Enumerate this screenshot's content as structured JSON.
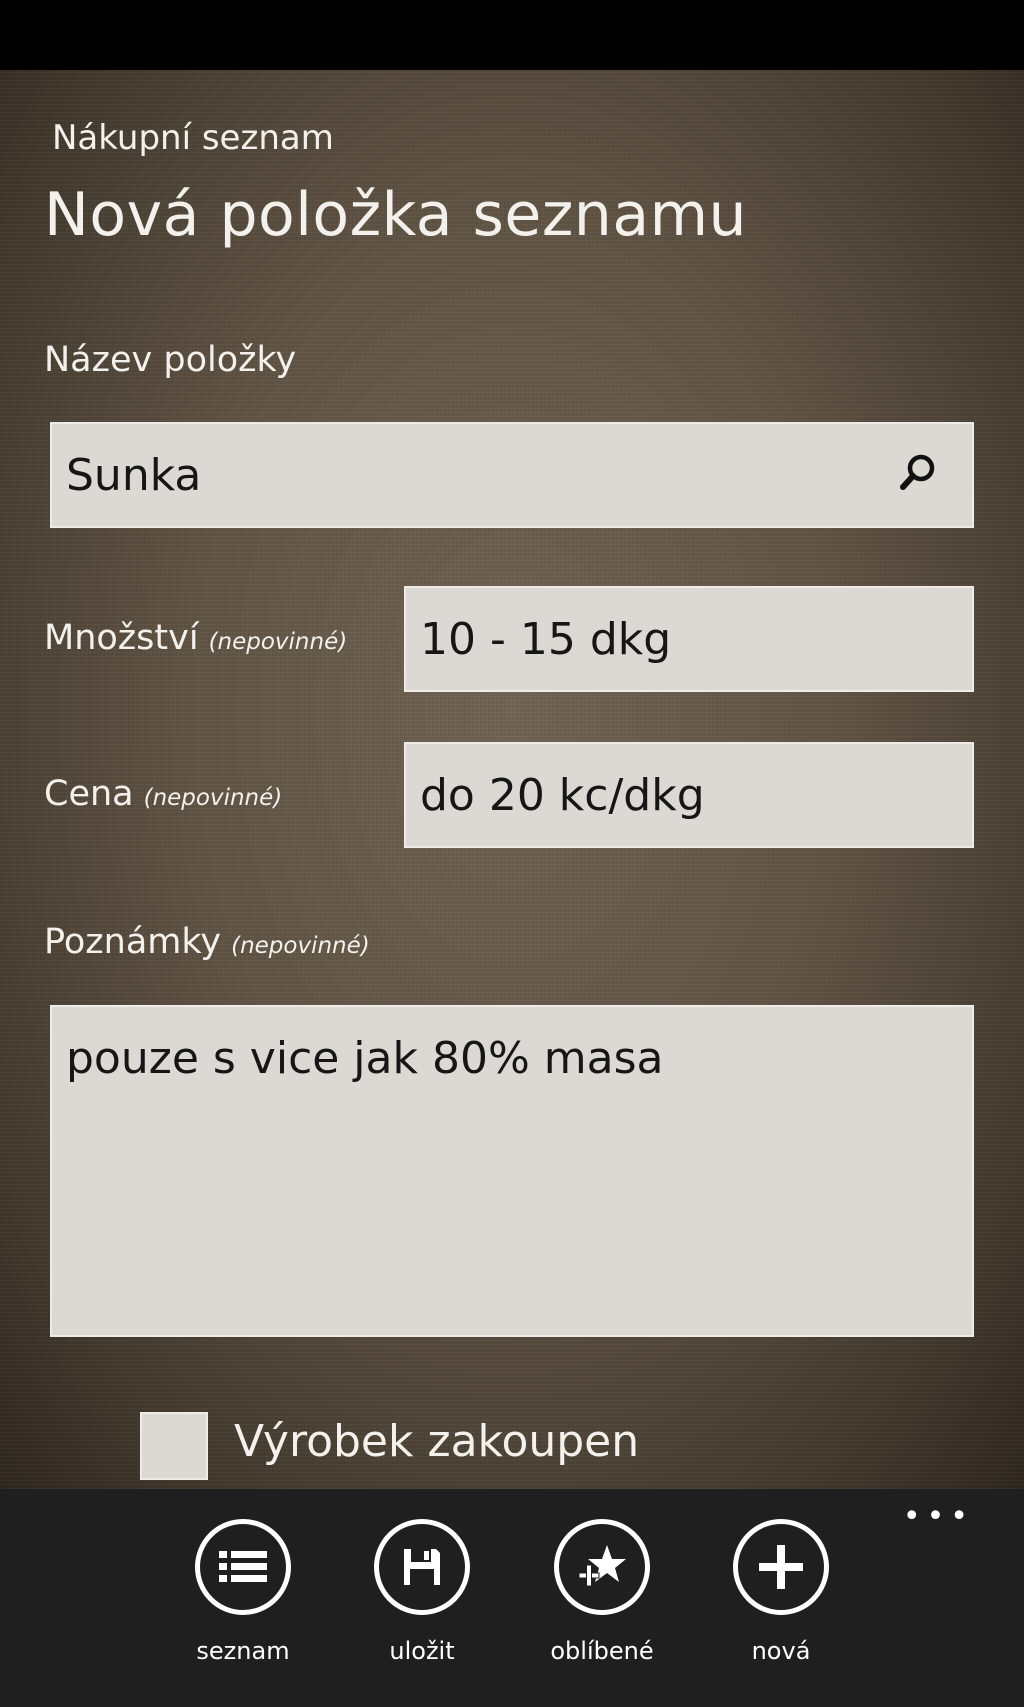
{
  "header": {
    "app_title": "Nákupní seznam",
    "page_title": "Nová položka seznamu"
  },
  "form": {
    "name_label": "Název položky",
    "name_value": "Sunka",
    "quantity_label": "Množství",
    "quantity_optional": "(nepovinné)",
    "quantity_value": "10 - 15 dkg",
    "price_label": "Cena",
    "price_optional": "(nepovinné)",
    "price_value": "do 20 kc/dkg",
    "notes_label": "Poznámky",
    "notes_optional": "(nepovinné)",
    "notes_value": "pouze s vice jak 80% masa",
    "purchased_label": "Výrobek zakoupen"
  },
  "app_bar": {
    "buttons": [
      {
        "label": "seznam",
        "icon": "list-icon"
      },
      {
        "label": "uložit",
        "icon": "save-icon"
      },
      {
        "label": "oblíbené",
        "icon": "favorite-add-icon"
      },
      {
        "label": "nová",
        "icon": "add-icon"
      }
    ],
    "more": "•••"
  },
  "colors": {
    "background": "#5f5344",
    "field": "#dcd9d4",
    "app_bar": "#1f1f1f",
    "text_light": "#f4f1ec"
  }
}
